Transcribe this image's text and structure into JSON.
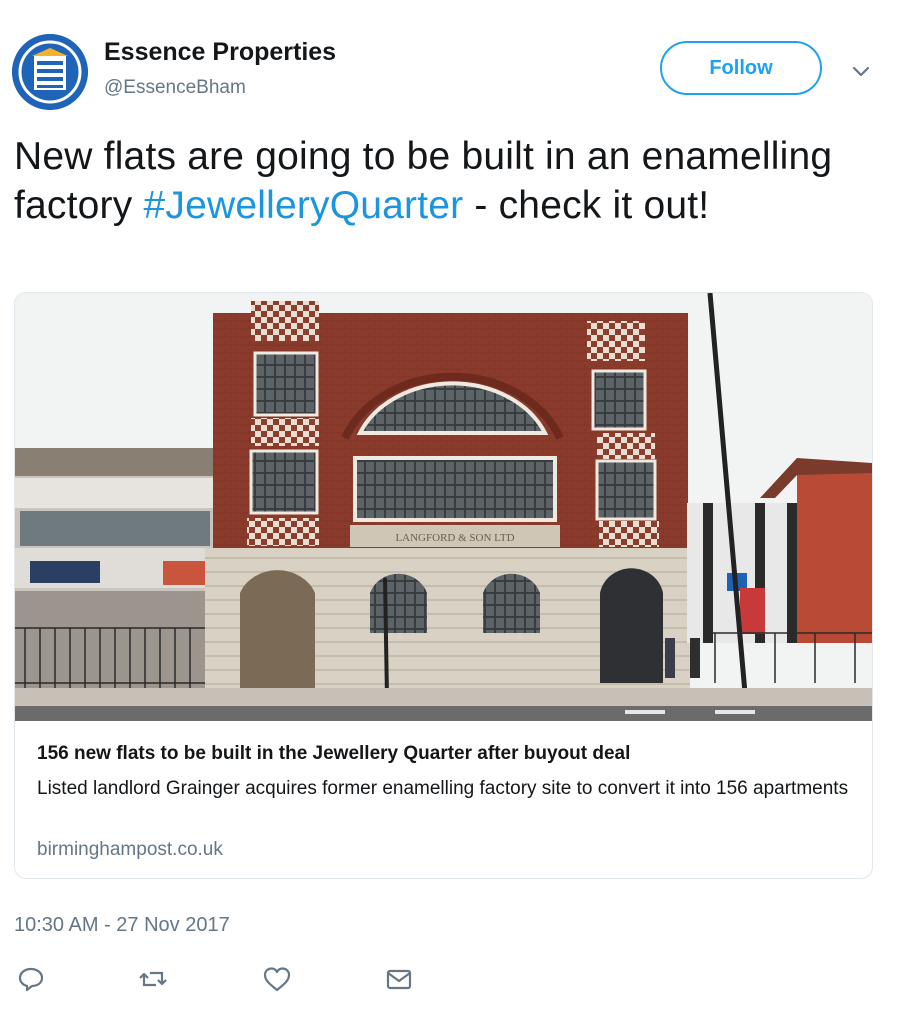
{
  "author": {
    "name": "Essence Properties",
    "handle": "@EssenceBham",
    "avatar_color": "#1f64b8"
  },
  "follow_button": {
    "label": "Follow",
    "color": "#1da1f2"
  },
  "menu": {
    "icon": "chevron-down-icon"
  },
  "tweet": {
    "text_before": "New flats are going to be built in an enamelling factory ",
    "hashtag": "#JewelleryQuarter",
    "text_after": " - check it out!",
    "hashtag_color": "#1b95e0"
  },
  "card": {
    "image_alt": "Brick building",
    "title": "156 new flats to be built in the Jewellery Quarter after buyout deal",
    "description": "Listed landlord Grainger acquires former enamelling factory site to convert it into 156 apartments",
    "domain": "birminghampost.co.uk"
  },
  "timestamp": "10:30 AM - 27 Nov 2017",
  "actions": [
    {
      "icon": "reply-icon"
    },
    {
      "icon": "retweet-icon"
    },
    {
      "icon": "like-icon"
    },
    {
      "icon": "message-icon"
    }
  ]
}
